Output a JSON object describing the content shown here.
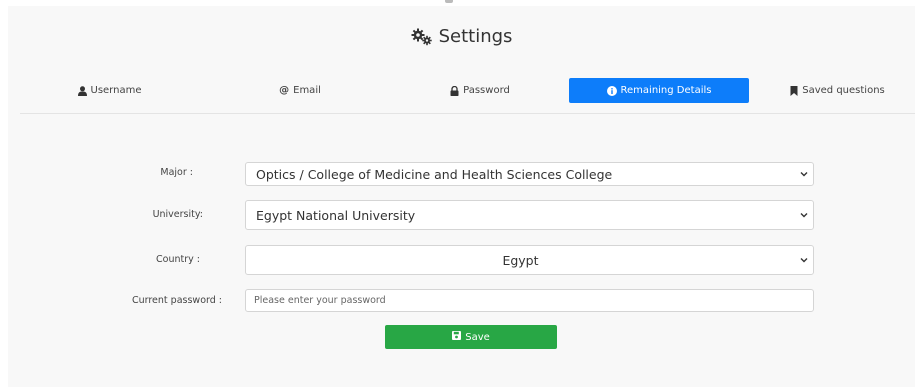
{
  "header": {
    "title": "Settings"
  },
  "tabs": [
    {
      "label": "Username",
      "icon": "user-icon"
    },
    {
      "label": "Email",
      "icon": "at-icon"
    },
    {
      "label": "Password",
      "icon": "lock-icon"
    },
    {
      "label": "Remaining Details",
      "icon": "info-icon",
      "active": true
    },
    {
      "label": "Saved questions",
      "icon": "bookmark-icon"
    }
  ],
  "form": {
    "major": {
      "label": "Major :",
      "value": "Optics / College of Medicine and Health Sciences College"
    },
    "university": {
      "label": "University:",
      "value": "Egypt National University"
    },
    "country": {
      "label": "Country :",
      "value": "Egypt"
    },
    "password": {
      "label": "Current password :",
      "placeholder": "Please enter your password"
    },
    "save_label": "Save"
  },
  "colors": {
    "active_tab": "#0d7dfa",
    "save_button": "#28a745",
    "panel_bg": "#f8f8f8"
  }
}
